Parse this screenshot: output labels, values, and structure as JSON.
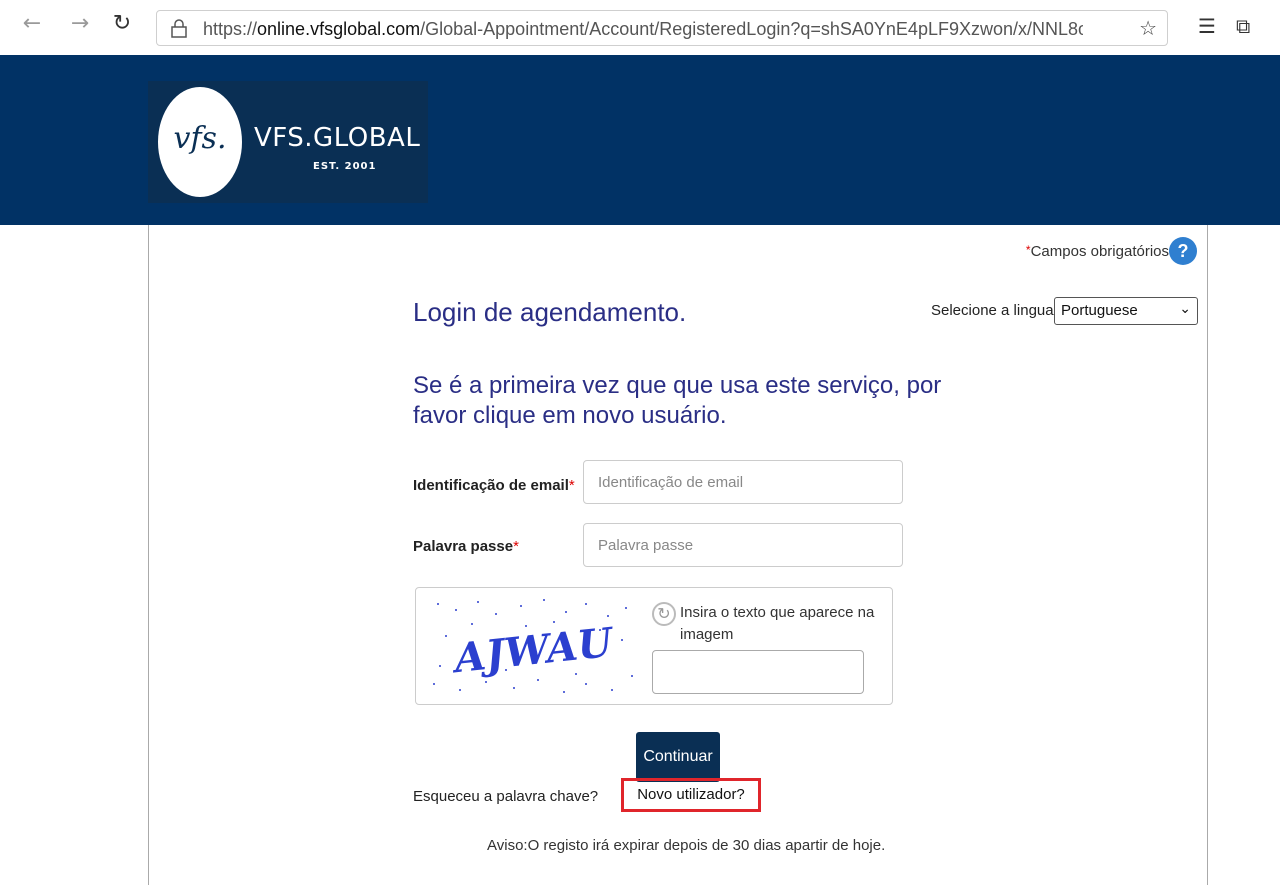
{
  "browser": {
    "url_prefix": "https://",
    "url_host": "online.vfsglobal.com",
    "url_path": "/Global-Appointment/Account/RegisteredLogin?q=shSA0YnE4pLF9Xzwon/x/NNL8oYEDVvii...",
    "icons": {
      "back": "back-arrow-icon",
      "forward": "forward-arrow-icon",
      "refresh": "refresh-icon",
      "lock": "lock-icon",
      "favorite": "star-icon",
      "favorites_list": "favorites-list-icon",
      "collections": "collections-icon"
    }
  },
  "header": {
    "logo_mark": "vfs.",
    "brand": "VFS.GLOBAL",
    "est": "EST. 2001",
    "bg_color": "#013265"
  },
  "form": {
    "required_asterisk": "*",
    "required_note": "Campos obrigatórios",
    "help_glyph": "?",
    "title": "Login de agendamento.",
    "language_label": "Selecione a lingua",
    "language_selected": "Portuguese",
    "subtitle": "Se é a primeira vez que que usa este serviço, por favor clique em novo usuário.",
    "email_label": "Identificação de email",
    "email_placeholder": "Identificação de email",
    "password_label": "Palavra passe",
    "password_placeholder": "Palavra passe",
    "captcha_text": "AJWAU",
    "captcha_prompt": "Insira o texto que aparece na imagem",
    "continue_label": "Continuar",
    "forgot_label": "Esqueceu a palavra chave?",
    "new_user_label": "Novo utilizador?",
    "notice": "Aviso:O registo irá expirar depois de 30 dias apartir de hoje."
  },
  "colors": {
    "title": "#2a2e85",
    "button": "#0a2f54",
    "highlight": "#e0252b"
  }
}
